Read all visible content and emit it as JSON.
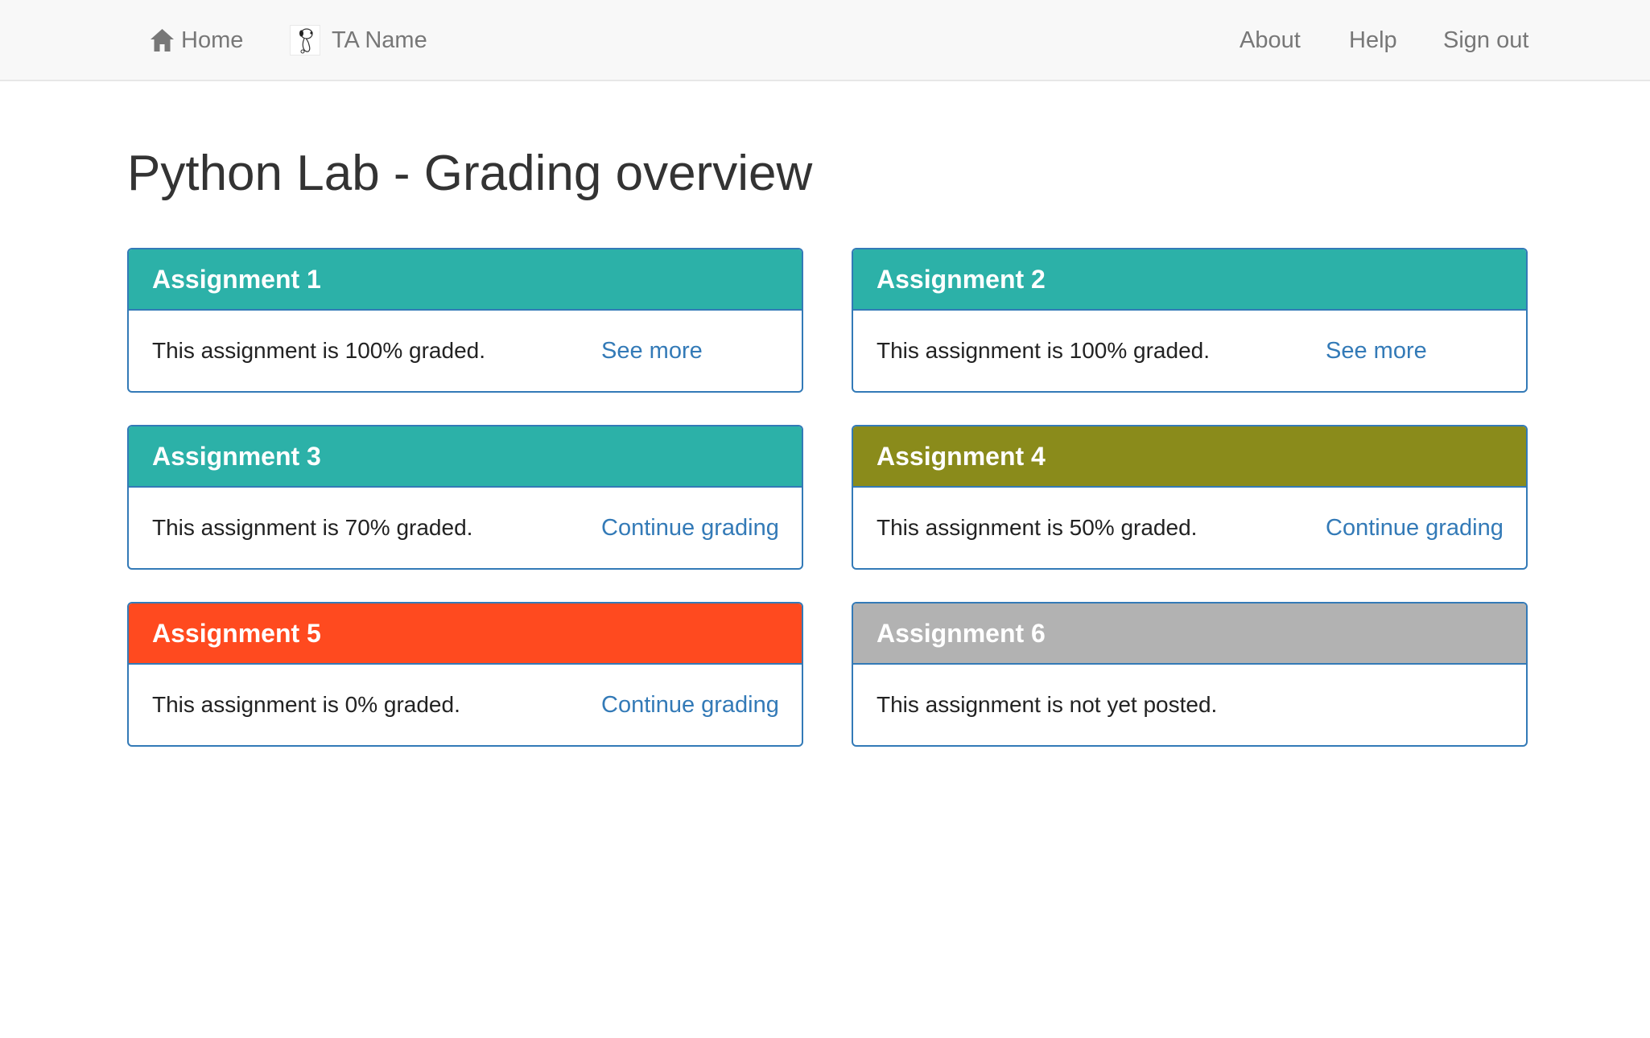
{
  "nav": {
    "home_label": "Home",
    "user_label": "TA Name",
    "about_label": "About",
    "help_label": "Help",
    "signout_label": "Sign out"
  },
  "page": {
    "title": "Python Lab - Grading overview"
  },
  "colors": {
    "complete": "#2cb1a8",
    "in_progress": "#8a8b1b",
    "not_started": "#ff4a1f",
    "not_posted": "#b2b2b2",
    "panel_border": "#337ab7",
    "link": "#337ab7"
  },
  "assignments": [
    {
      "title": "Assignment 1",
      "status_text": "This assignment is 100% graded.",
      "link_label": "See more",
      "graded_percent": 100
    },
    {
      "title": "Assignment 2",
      "status_text": "This assignment is 100% graded.",
      "link_label": "See more",
      "graded_percent": 100
    },
    {
      "title": "Assignment 3",
      "status_text": "This assignment is 70% graded.",
      "link_label": "Continue grading",
      "graded_percent": 70
    },
    {
      "title": "Assignment 4",
      "status_text": "This assignment is 50% graded.",
      "link_label": "Continue grading",
      "graded_percent": 50
    },
    {
      "title": "Assignment 5",
      "status_text": "This assignment is 0% graded.",
      "link_label": "Continue grading",
      "graded_percent": 0
    },
    {
      "title": "Assignment 6",
      "status_text": "This assignment is not yet posted.",
      "link_label": "",
      "graded_percent": null
    }
  ]
}
